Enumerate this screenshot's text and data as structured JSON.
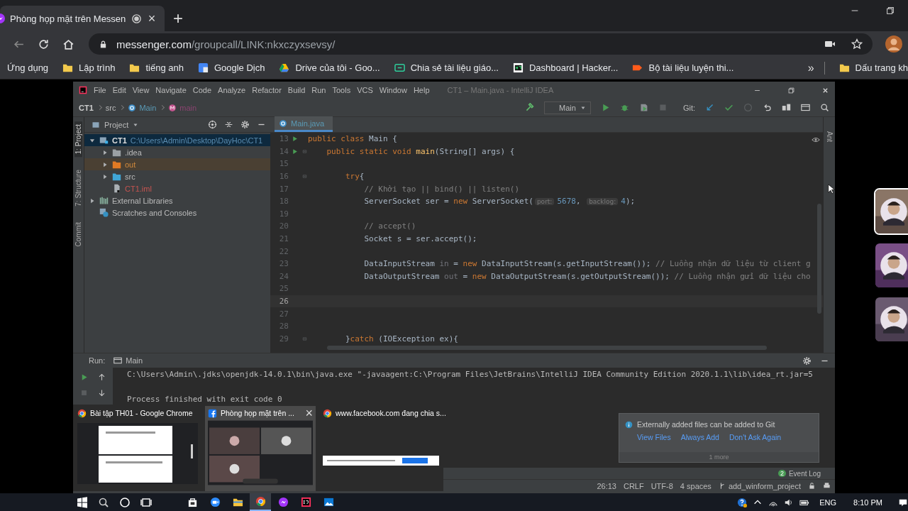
{
  "browser": {
    "tab": {
      "title": "Phòng họp mặt trên Messen",
      "recording": true,
      "close": "×"
    },
    "new_tab": "+",
    "address": {
      "domain": "messenger.com",
      "path": "/groupcall/LINK:nkxczyxsevsy/"
    },
    "bookmarks": [
      {
        "label": "Ứng dụng",
        "kind": "none"
      },
      {
        "label": "Lập trình",
        "kind": "folder"
      },
      {
        "label": "tiếng anh",
        "kind": "folder"
      },
      {
        "label": "Google Dịch",
        "kind": "translate"
      },
      {
        "label": "Drive của tôi - Goo...",
        "kind": "drive"
      },
      {
        "label": "Chia sẻ tài liệu giáo...",
        "kind": "code"
      },
      {
        "label": "Dashboard | Hacker...",
        "kind": "hr"
      },
      {
        "label": "Bộ tài liệu luyện thi...",
        "kind": "tag"
      }
    ],
    "bookmarks_more": "»",
    "other_bookmarks": "Dấu trang kh"
  },
  "ide": {
    "menu": [
      "File",
      "Edit",
      "View",
      "Navigate",
      "Code",
      "Analyze",
      "Refactor",
      "Build",
      "Run",
      "Tools",
      "VCS",
      "Window",
      "Help"
    ],
    "title": "CT1 – Main.java - IntelliJ IDEA",
    "breadcrumbs": [
      {
        "label": "CT1",
        "kind": "project"
      },
      {
        "label": "src",
        "kind": "folder"
      },
      {
        "label": "Main",
        "kind": "class"
      },
      {
        "label": "main",
        "kind": "method"
      }
    ],
    "run_config": "Main",
    "vcs_label": "Git:",
    "side_tabs": [
      {
        "label": "1: Project",
        "selected": true
      },
      {
        "label": "7: Structure",
        "selected": false
      },
      {
        "label": "Commit",
        "selected": false
      }
    ],
    "right_tabs": [
      "Ant"
    ],
    "project": {
      "header": "Project",
      "tree": [
        {
          "label": "CT1",
          "path": "C:\\Users\\Admin\\Desktop\\DayHoc\\CT1",
          "kind": "module",
          "expanded": true,
          "selected": true,
          "children": [
            {
              "label": ".idea",
              "kind": "folder",
              "expanded": false,
              "selected": false
            },
            {
              "label": "out",
              "kind": "excluded",
              "expanded": false,
              "selected": false
            },
            {
              "label": "src",
              "kind": "source",
              "expanded": false,
              "selected": false
            },
            {
              "label": "CT1.iml",
              "kind": "iml",
              "selected": false
            }
          ]
        },
        {
          "label": "External Libraries",
          "kind": "libraries",
          "expanded": false,
          "selected": false
        },
        {
          "label": "Scratches and Consoles",
          "kind": "scratch",
          "selected": false
        }
      ]
    },
    "editor": {
      "tab": "Main.java",
      "lines": [
        {
          "number": "13",
          "runnable": true,
          "fold": false,
          "current": false,
          "tokens": [
            {
              "text": "public class ",
              "kind": "kw"
            },
            {
              "text": "Main {",
              "kind": "plain"
            }
          ]
        },
        {
          "number": "14",
          "runnable": true,
          "fold": true,
          "current": false,
          "tokens": [
            {
              "text": "    public static void ",
              "kind": "kw"
            },
            {
              "text": "main",
              "kind": "method"
            },
            {
              "text": "(String[] args) {",
              "kind": "plain"
            }
          ]
        },
        {
          "number": "15",
          "runnable": false,
          "fold": false,
          "current": false
        },
        {
          "number": "16",
          "runnable": false,
          "fold": true,
          "current": false,
          "tokens": [
            {
              "text": "        try",
              "kind": "kw"
            },
            {
              "text": "{",
              "kind": "plain"
            }
          ]
        },
        {
          "number": "17",
          "runnable": false,
          "fold": false,
          "current": false,
          "tokens": [
            {
              "text": "            // Khởi tạo || bind() || listen()",
              "kind": "comment"
            }
          ]
        },
        {
          "number": "18",
          "runnable": false,
          "fold": false,
          "current": false,
          "tokens": [
            {
              "text": "            ServerSocket ser = ",
              "kind": "plain"
            },
            {
              "text": "new ",
              "kind": "kw"
            },
            {
              "text": "ServerSocket(",
              "kind": "plain"
            },
            {
              "text": "port:",
              "kind": "hint"
            },
            {
              "text": "5678",
              "kind": "num"
            },
            {
              "text": ", ",
              "kind": "plain"
            },
            {
              "text": "backlog:",
              "kind": "hint"
            },
            {
              "text": "4",
              "kind": "num"
            },
            {
              "text": ");",
              "kind": "plain"
            }
          ]
        },
        {
          "number": "19",
          "runnable": false,
          "fold": false,
          "current": false
        },
        {
          "number": "20",
          "runnable": false,
          "fold": false,
          "current": false,
          "tokens": [
            {
              "text": "            // accept()",
              "kind": "comment"
            }
          ]
        },
        {
          "number": "21",
          "runnable": false,
          "fold": false,
          "current": false,
          "tokens": [
            {
              "text": "            Socket s = ser.accept();",
              "kind": "plain"
            }
          ]
        },
        {
          "number": "22",
          "runnable": false,
          "fold": false,
          "current": false
        },
        {
          "number": "23",
          "runnable": false,
          "fold": false,
          "current": false,
          "tokens": [
            {
              "text": "            DataInputStream ",
              "kind": "plain"
            },
            {
              "text": "in",
              "kind": "unused"
            },
            {
              "text": " = ",
              "kind": "plain"
            },
            {
              "text": "new ",
              "kind": "kw"
            },
            {
              "text": "DataInputStream(s.getInputStream()); ",
              "kind": "plain"
            },
            {
              "text": "// Luồng nhận dữ liệu từ client g",
              "kind": "comment"
            }
          ]
        },
        {
          "number": "24",
          "runnable": false,
          "fold": false,
          "current": false,
          "tokens": [
            {
              "text": "            DataOutputStream ",
              "kind": "plain"
            },
            {
              "text": "out",
              "kind": "unused"
            },
            {
              "text": " = ",
              "kind": "plain"
            },
            {
              "text": "new ",
              "kind": "kw"
            },
            {
              "text": "DataOutputStream(s.getOutputStream()); ",
              "kind": "plain"
            },
            {
              "text": "// Luồng nhận gửi dữ liệu cho",
              "kind": "comment"
            }
          ]
        },
        {
          "number": "25",
          "runnable": false,
          "fold": false,
          "current": false
        },
        {
          "number": "26",
          "runnable": false,
          "fold": false,
          "current": true
        },
        {
          "number": "27",
          "runnable": false,
          "fold": false,
          "current": false
        },
        {
          "number": "28",
          "runnable": false,
          "fold": false,
          "current": false
        },
        {
          "number": "29",
          "runnable": false,
          "fold": true,
          "current": false,
          "tokens": [
            {
              "text": "        }",
              "kind": "plain"
            },
            {
              "text": "catch ",
              "kind": "kw"
            },
            {
              "text": "(IOException ex){",
              "kind": "plain"
            }
          ]
        }
      ]
    },
    "run": {
      "label": "Run:",
      "tab": "Main",
      "lines": [
        "C:\\Users\\Admin\\.jdks\\openjdk-14.0.1\\bin\\java.exe \"-javaagent:C:\\Program Files\\JetBrains\\IntelliJ IDEA Community Edition 2020.1.1\\lib\\idea_rt.jar=5",
        "Process finished with exit code 0"
      ]
    },
    "event_log": {
      "count": "2",
      "label": "Event Log"
    },
    "status": [
      "26:13",
      "CRLF",
      "UTF-8",
      "4 spaces"
    ],
    "branch": "add_winform_project",
    "notification": {
      "text": "Externally added files can be added to Git",
      "actions": [
        "View Files",
        "Always Add",
        "Don't Ask Again"
      ],
      "more": "1 more"
    }
  },
  "participants": [
    {
      "kind": "picture",
      "selected": true
    },
    {
      "kind": "picture",
      "selected": false
    },
    {
      "kind": "picture",
      "selected": false
    }
  ],
  "thumbnails": [
    {
      "title": "Bài tập TH01 - Google Chrome",
      "kind": "document",
      "selected": false
    },
    {
      "title": "Phòng họp mặt trên ...",
      "kind": "call",
      "selected": true,
      "close": "×"
    },
    {
      "title": "www.facebook.com đang chia s...",
      "kind": "bar",
      "selected": false
    }
  ],
  "taskbar": {
    "apps": [
      {
        "kind": "store",
        "active": false
      },
      {
        "kind": "zoom",
        "active": false
      },
      {
        "kind": "explorer",
        "active": false
      },
      {
        "kind": "chrome",
        "active": true
      },
      {
        "kind": "messenger",
        "active": false
      },
      {
        "kind": "intellij",
        "active": false
      },
      {
        "kind": "photos",
        "active": false
      }
    ],
    "language": "ENG",
    "time": "8:10 PM"
  }
}
